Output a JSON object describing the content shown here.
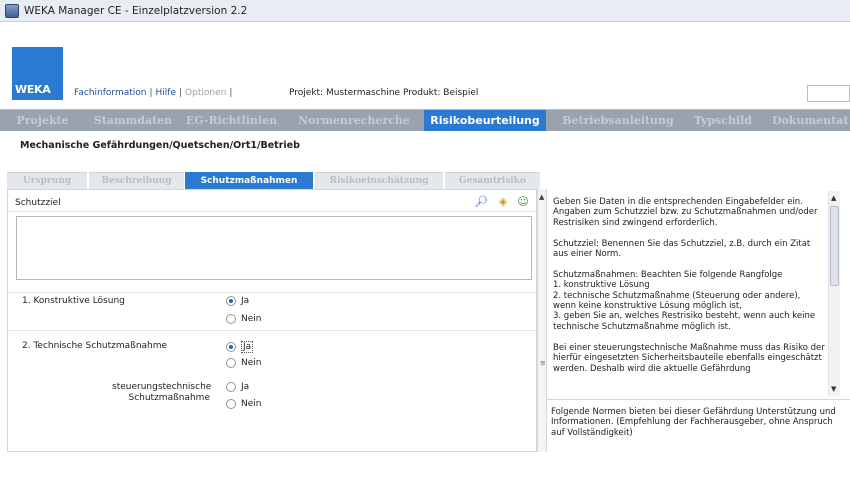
{
  "window": {
    "title": "WEKA Manager CE - Einzelplatzversion 2.2"
  },
  "header": {
    "logo": "WEKA",
    "nav": [
      "Fachinformation",
      "Hilfe",
      "Optionen"
    ],
    "project": "Projekt: Mustermaschine Produkt: Beispiel"
  },
  "main_tabs": [
    "Projekte",
    "Stammdaten",
    "EG-Richtlinien",
    "Normenrecherche",
    "Risikobeurteilung",
    "Betriebsanleitung",
    "Typschild",
    "Dokumentat"
  ],
  "main_tabs_active": "Risikobeurteilung",
  "breadcrumb": "Mechanische Gefährdungen/Quetschen/Ort1/Betrieb",
  "sub_tabs": [
    "Ursprung",
    "Beschreibung",
    "Schutzmaßnahmen",
    "Risikoeinschätzung",
    "Gesamtrisiko"
  ],
  "sub_tabs_active": "Schutzmaßnahmen",
  "form": {
    "schutzziel_label": "Schutzziel",
    "q1": {
      "label": "1. Konstruktive Lösung",
      "opt_yes": "Ja",
      "opt_no": "Nein",
      "selected": "Ja"
    },
    "q2": {
      "label": "2. Technische Schutzmaßnahme",
      "opt_yes": "Ja",
      "opt_no": "Nein",
      "selected": "Ja"
    },
    "q3": {
      "label_line1": "steuerungstechnische",
      "label_line2": "Schutzmaßnahme",
      "opt_yes": "Ja",
      "opt_no": "Nein",
      "selected": ""
    }
  },
  "help": {
    "text": "Geben Sie Daten in die entsprechenden Eingabefelder ein. Angaben zum Schutzziel bzw. zu Schutzmaßnahmen und/oder Restrisiken sind zwingend erforderlich.\n\nSchutzziel: Benennen Sie das Schutzziel, z.B. durch ein Zitat aus einer Norm.\n\nSchutzmaßnahmen: Beachten Sie folgende Rangfolge\n1. konstruktive Lösung\n2. technische Schutzmaßnahme (Steuerung oder andere), wenn keine konstruktive Lösung möglich ist,\n3. geben Sie an, welches Restrisiko besteht, wenn auch keine technische Schutzmaßnahme möglich ist.\n\nBei einer steuerungstechnische Maßnahme muss das Risiko der hierfür eingesetzten Sicherheitsbauteile ebenfalls eingeschätzt werden. Deshalb wird die aktuelle Gefährdung",
    "norms": "Folgende Normen bieten bei dieser Gefährdung Unterstützung und Informationen. (Empfehlung der Fachherausgeber, ohne Anspruch auf Vollständigkeit)"
  },
  "colors": {
    "accent": "#2a7ad2",
    "tabbar": "#9aa3ad"
  }
}
